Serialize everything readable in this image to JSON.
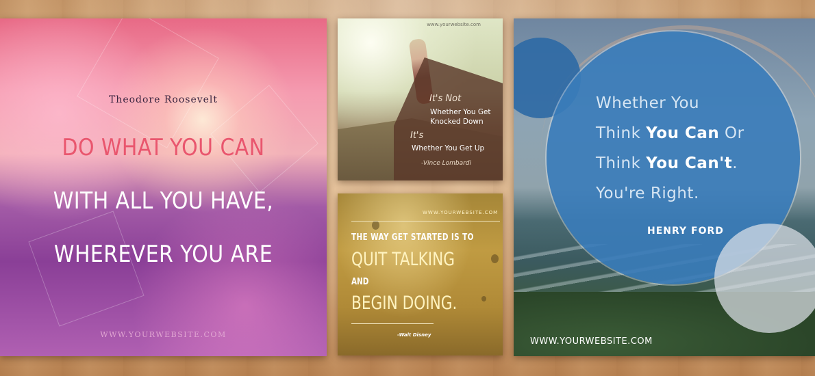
{
  "background": {
    "color": "#d7a87a"
  },
  "card1": {
    "author": "Theodore Roosevelt",
    "lines": [
      "DO WHAT YOU CAN",
      "WITH ALL YOU HAVE,",
      "WHEREVER YOU ARE"
    ],
    "accent": "#e9566e",
    "website": "WWW.YOURWEBSITE.COM"
  },
  "card2": {
    "website": "www.yourwebsite.com",
    "heading1": "It's Not",
    "line1": "Whether You Get",
    "line2": "Knocked Down",
    "heading2": "It's",
    "line3": "Whether You Get Up",
    "author": "-Vince Lombardi"
  },
  "card3": {
    "website": "WWW.YOURWEBSITE.COM",
    "line1": "THE WAY GET STARTED IS TO",
    "line2": "QUIT TALKING",
    "line3": "AND",
    "line4": "BEGIN DOING.",
    "author": "-Walt Disney"
  },
  "card4": {
    "r1": "Whether You",
    "r2a": "Think ",
    "r2b": "You Can",
    "r2c": " Or",
    "r3a": "Think ",
    "r3b": "You Can't",
    "r3c": ".",
    "r4": "You're Right.",
    "author": "HENRY FORD",
    "website": "WWW.YOURWEBSITE.COM",
    "circle_color": "#3a7cba"
  }
}
